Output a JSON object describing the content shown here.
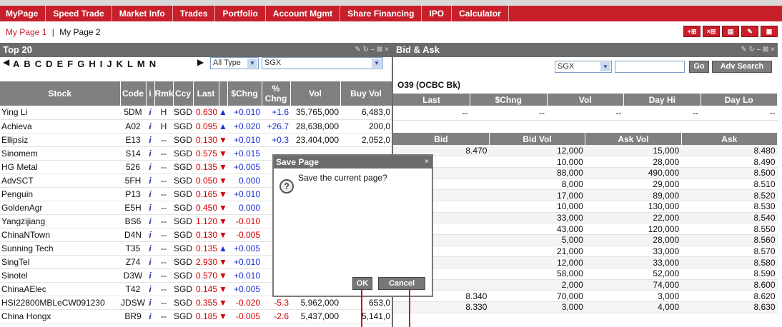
{
  "nav": [
    "MyPage",
    "Speed Trade",
    "Market Info",
    "Trades",
    "Portfolio",
    "Account Mgmt",
    "Share Financing",
    "IPO",
    "Calculator"
  ],
  "pages": {
    "page1": "My Page 1",
    "sep": "|",
    "page2": "My Page 2"
  },
  "top20": {
    "title": "Top 20",
    "ctrls": "✎ ↻ – ⊠ ×",
    "letters": [
      "A",
      "B",
      "C",
      "D",
      "E",
      "F",
      "G",
      "H",
      "I",
      "J",
      "K",
      "L",
      "M",
      "N"
    ],
    "type_select": "All Type",
    "exchange_select": "SGX",
    "headers": [
      "Stock",
      "Code",
      "i",
      "Rmk",
      "Ccy",
      "Last",
      "",
      "$Chng",
      "% Chng",
      "Vol",
      "Buy Vol"
    ],
    "rows": [
      [
        "Ying Li",
        "5DM",
        "i",
        "H",
        "SGD",
        "0.630",
        "▲",
        "+0.010",
        "+1.6",
        "35,765,000",
        "6,483,0"
      ],
      [
        "Achieva",
        "A02",
        "i",
        "H",
        "SGD",
        "0.095",
        "▲",
        "+0.020",
        "+26.7",
        "28,638,000",
        "200,0"
      ],
      [
        "Ellipsiz",
        "E13",
        "i",
        "--",
        "SGD",
        "0.130",
        "▼",
        "+0.010",
        "+0.3",
        "23,404,000",
        "2,052,0"
      ],
      [
        "Sinomem",
        "S14",
        "i",
        "--",
        "SGD",
        "0.575",
        "▼",
        "+0.015",
        "",
        "",
        ""
      ],
      [
        "HG Metal",
        "526",
        "i",
        "--",
        "SGD",
        "0.135",
        "▼",
        "+0.005",
        "",
        "",
        ""
      ],
      [
        "AdvSCT",
        "5FH",
        "i",
        "--",
        "SGD",
        "0.050",
        "▼",
        "0.000",
        "",
        "",
        ""
      ],
      [
        "Penguin",
        "P13",
        "i",
        "--",
        "SGD",
        "0.165",
        "▼",
        "+0.010",
        "",
        "",
        ""
      ],
      [
        "GoldenAgr",
        "E5H",
        "i",
        "--",
        "SGD",
        "0.450",
        "▼",
        "0.000",
        "",
        "",
        ""
      ],
      [
        "Yangzijiang",
        "BS6",
        "i",
        "--",
        "SGD",
        "1.120",
        "▼",
        "-0.010",
        "",
        "",
        ""
      ],
      [
        "ChinaNTown",
        "D4N",
        "i",
        "--",
        "SGD",
        "0.130",
        "▼",
        "-0.005",
        "",
        "",
        ""
      ],
      [
        "Sunning Tech",
        "T35",
        "i",
        "--",
        "SGD",
        "0.135",
        "▲",
        "+0.005",
        "",
        "",
        ""
      ],
      [
        "SingTel",
        "Z74",
        "i",
        "--",
        "SGD",
        "2.930",
        "▼",
        "+0.010",
        "",
        "",
        ""
      ],
      [
        "Sinotel",
        "D3W",
        "i",
        "--",
        "SGD",
        "0.570",
        "▼",
        "+0.010",
        "",
        "",
        ""
      ],
      [
        "ChinaAElec",
        "T42",
        "i",
        "--",
        "SGD",
        "0.145",
        "▼",
        "+0.005",
        "",
        "",
        ""
      ],
      [
        "HSI22800MBLeCW091230",
        "JDSW",
        "i",
        "--",
        "SGD",
        "0.355",
        "▼",
        "-0.020",
        "-5.3",
        "5,962,000",
        "653,0"
      ],
      [
        "China Hongx",
        "BR9",
        "i",
        "--",
        "SGD",
        "0.185",
        "▼",
        "-0.005",
        "-2.6",
        "5,437,000",
        "5,141,0"
      ]
    ]
  },
  "bidask": {
    "title": "Bid & Ask",
    "ctrls": "✎ ↻ – ⊠ ×",
    "exchange_select": "SGX",
    "search_placeholder": "",
    "go_label": "Go",
    "adv_search_label": "Adv Search",
    "symbol": "O39 (OCBC Bk)",
    "stat_headers": [
      "Last",
      "$Chng",
      "Vol",
      "Day Hi",
      "Day Lo"
    ],
    "stat_values": [
      "--",
      "--",
      "--",
      "--",
      "--"
    ],
    "ba_headers": [
      "Bid",
      "Bid Vol",
      "Ask Vol",
      "Ask"
    ],
    "rows": [
      [
        "8.470",
        "12,000",
        "15,000",
        "8.480"
      ],
      [
        "",
        "10,000",
        "28,000",
        "8.490"
      ],
      [
        "",
        "88,000",
        "490,000",
        "8.500"
      ],
      [
        "",
        "8,000",
        "29,000",
        "8.510"
      ],
      [
        "",
        "17,000",
        "89,000",
        "8.520"
      ],
      [
        "",
        "10,000",
        "130,000",
        "8.530"
      ],
      [
        "",
        "33,000",
        "22,000",
        "8.540"
      ],
      [
        "",
        "43,000",
        "120,000",
        "8.550"
      ],
      [
        "",
        "5,000",
        "28,000",
        "8.560"
      ],
      [
        "",
        "21,000",
        "33,000",
        "8.570"
      ],
      [
        "",
        "12,000",
        "33,000",
        "8.580"
      ],
      [
        "",
        "58,000",
        "52,000",
        "8.590"
      ],
      [
        "",
        "2,000",
        "74,000",
        "8.600"
      ],
      [
        "8.340",
        "70,000",
        "3,000",
        "8.620"
      ],
      [
        "8.330",
        "3,000",
        "4,000",
        "8.630"
      ]
    ]
  },
  "dialog": {
    "title": "Save Page",
    "close": "×",
    "icon": "?",
    "message": "Save the current page?",
    "ok_label": "OK",
    "cancel_label": "Cancel"
  },
  "colors": {
    "brand": "#c8202b",
    "header_gray": "#6b6b6b",
    "up": "#1a2fd1",
    "down": "#d10000"
  }
}
